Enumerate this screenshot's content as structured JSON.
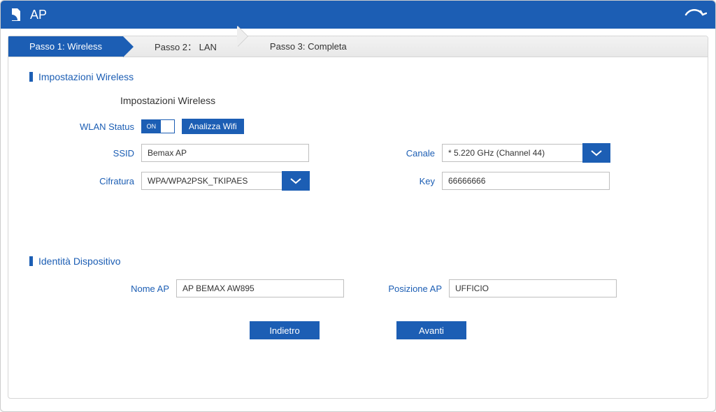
{
  "header": {
    "title": "AP"
  },
  "stepper": {
    "step1": "Passo 1: Wireless",
    "step2": "Passo 2： LAN",
    "step3": "Passo 3: Completa"
  },
  "sections": {
    "wireless": {
      "title": "Impostazioni Wireless",
      "subheading": "Impostazioni Wireless"
    },
    "identity": {
      "title": "Identità Dispositivo"
    }
  },
  "labels": {
    "wlan_status": "WLAN Status",
    "ssid": "SSID",
    "cifratura": "Cifratura",
    "canale": "Canale",
    "key": "Key",
    "nome_ap": "Nome AP",
    "posizione_ap": "Posizione AP"
  },
  "values": {
    "toggle_on": "ON",
    "analizza_wifi": "Analizza Wifi",
    "ssid": "Bemax AP",
    "cifratura": "WPA/WPA2PSK_TKIPAES",
    "canale": "* 5.220 GHz (Channel 44)",
    "key": "66666666",
    "nome_ap": "AP BEMAX AW895",
    "posizione_ap": "UFFICIO"
  },
  "buttons": {
    "indietro": "Indietro",
    "avanti": "Avanti"
  }
}
